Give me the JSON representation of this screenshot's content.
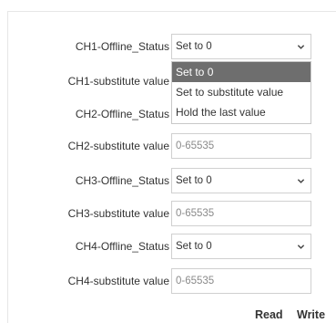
{
  "rows": [
    {
      "label": "CH1-Offline_Status",
      "value": "Set to 0"
    },
    {
      "label": "CH1-substitute value",
      "value": ""
    },
    {
      "label": "CH2-Offline_Status",
      "value": ""
    },
    {
      "label": "CH2-substitute value",
      "placeholder": "0-65535"
    },
    {
      "label": "CH3-Offline_Status",
      "value": "Set to 0"
    },
    {
      "label": "CH3-substitute value",
      "placeholder": "0-65535"
    },
    {
      "label": "CH4-Offline_Status",
      "value": "Set to 0"
    },
    {
      "label": "CH4-substitute value",
      "placeholder": "0-65535"
    }
  ],
  "dropdown": {
    "options": [
      "Set to 0",
      "Set to substitute value",
      "Hold the last value"
    ],
    "selected": "Set to 0"
  },
  "buttons": {
    "read": "Read",
    "write": "Write"
  },
  "icons": {
    "select_arrow": "chevron-down-icon"
  }
}
